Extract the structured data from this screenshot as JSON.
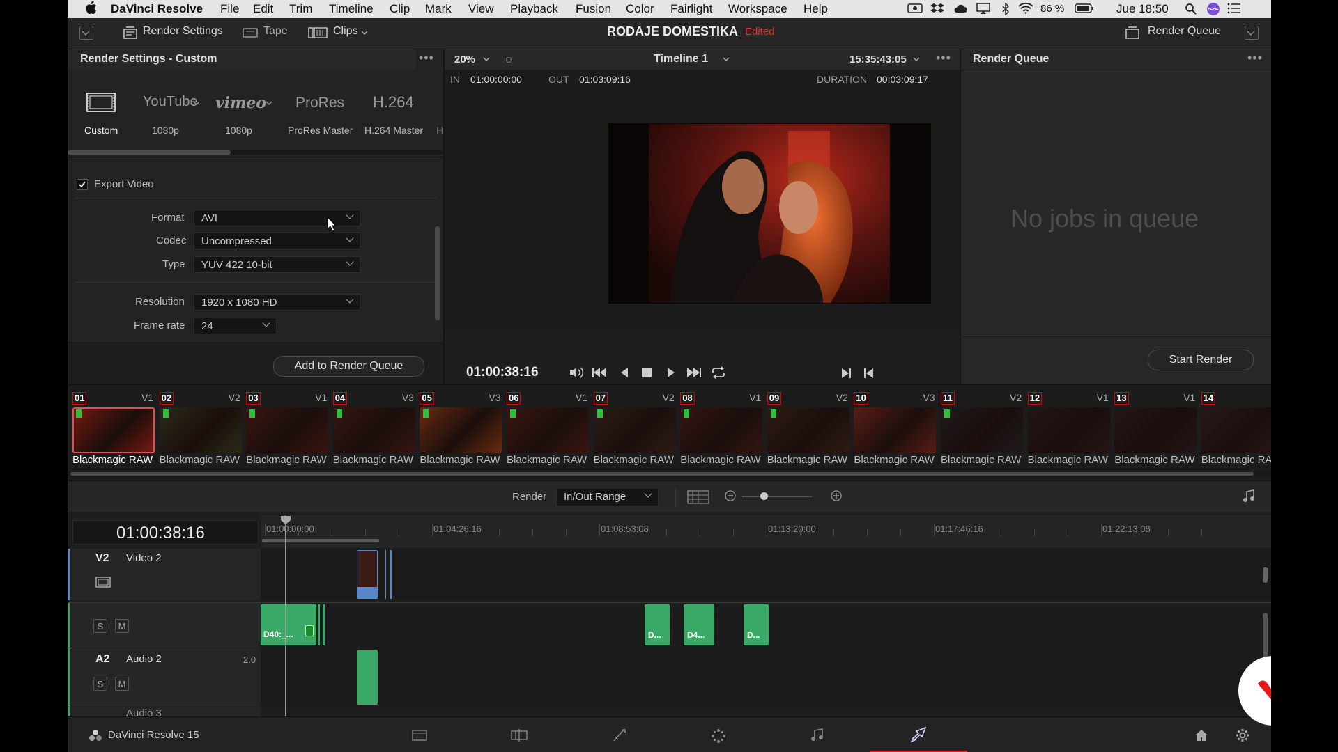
{
  "menubar": {
    "app_name": "DaVinci Resolve",
    "items": [
      "File",
      "Edit",
      "Trim",
      "Timeline",
      "Clip",
      "Mark",
      "View",
      "Playback",
      "Fusion",
      "Color",
      "Fairlight",
      "Workspace",
      "Help"
    ],
    "battery": "86 %",
    "clock": "Jue 18:50"
  },
  "toolbar": {
    "render_settings": "Render Settings",
    "tape": "Tape",
    "clips": "Clips",
    "project_name": "RODAJE DOMESTIKA",
    "edited": "Edited",
    "render_queue": "Render Queue"
  },
  "render_settings": {
    "title": "Render Settings - Custom",
    "presets": [
      {
        "name": "custom",
        "icon": "film-frame-icon",
        "label": "Custom"
      },
      {
        "name": "youtube",
        "icon": "YouTube",
        "label": "1080p"
      },
      {
        "name": "vimeo",
        "icon": "vimeo",
        "label": "1080p"
      },
      {
        "name": "prores",
        "icon": "ProRes",
        "label": "ProRes Master"
      },
      {
        "name": "h264",
        "icon": "H.264",
        "label": "H.264 Master"
      },
      {
        "name": "more",
        "icon": "",
        "label": "H"
      }
    ],
    "export_video_label": "Export Video",
    "export_video_checked": true,
    "fields": {
      "format": {
        "label": "Format",
        "value": "AVI"
      },
      "codec": {
        "label": "Codec",
        "value": "Uncompressed"
      },
      "type": {
        "label": "Type",
        "value": "YUV 422 10-bit"
      },
      "resolution": {
        "label": "Resolution",
        "value": "1920 x 1080 HD"
      },
      "frame_rate": {
        "label": "Frame rate",
        "value": "24"
      }
    },
    "add_to_queue": "Add to Render Queue"
  },
  "viewer": {
    "zoom": "20%",
    "timeline_name": "Timeline 1",
    "timecode_top": "15:35:43:05",
    "in_label": "IN",
    "in_value": "01:00:00:00",
    "out_label": "OUT",
    "out_value": "01:03:09:16",
    "duration_label": "DURATION",
    "duration_value": "00:03:09:17",
    "current_timecode": "01:00:38:16"
  },
  "render_queue": {
    "title": "Render Queue",
    "empty_message": "No jobs in queue",
    "start_render": "Start Render"
  },
  "clips": [
    {
      "num": "01",
      "track": "V1",
      "name": "Blackmagic RAW",
      "flag": true,
      "selected": true,
      "color": "#7a1a10"
    },
    {
      "num": "02",
      "track": "V2",
      "name": "Blackmagic RAW",
      "flag": true,
      "selected": false,
      "color": "#2b2b18"
    },
    {
      "num": "03",
      "track": "V1",
      "name": "Blackmagic RAW",
      "flag": true,
      "selected": false,
      "color": "#3a1410"
    },
    {
      "num": "04",
      "track": "V3",
      "name": "Blackmagic RAW",
      "flag": true,
      "selected": false,
      "color": "#351512"
    },
    {
      "num": "05",
      "track": "V3",
      "name": "Blackmagic RAW",
      "flag": true,
      "selected": false,
      "color": "#6a2a10"
    },
    {
      "num": "06",
      "track": "V1",
      "name": "Blackmagic RAW",
      "flag": true,
      "selected": false,
      "color": "#3b1612"
    },
    {
      "num": "07",
      "track": "V2",
      "name": "Blackmagic RAW",
      "flag": true,
      "selected": false,
      "color": "#2d1c16"
    },
    {
      "num": "08",
      "track": "V1",
      "name": "Blackmagic RAW",
      "flag": true,
      "selected": false,
      "color": "#341512"
    },
    {
      "num": "09",
      "track": "V2",
      "name": "Blackmagic RAW",
      "flag": true,
      "selected": false,
      "color": "#2f1a14"
    },
    {
      "num": "10",
      "track": "V3",
      "name": "Blackmagic RAW",
      "flag": false,
      "selected": false,
      "color": "#5a1d15"
    },
    {
      "num": "11",
      "track": "V2",
      "name": "Blackmagic RAW",
      "flag": true,
      "selected": false,
      "color": "#1e1a1a"
    },
    {
      "num": "12",
      "track": "V1",
      "name": "Blackmagic RAW",
      "flag": false,
      "selected": false,
      "color": "#241515"
    },
    {
      "num": "13",
      "track": "V1",
      "name": "Blackmagic RAW",
      "flag": false,
      "selected": false,
      "color": "#231616"
    },
    {
      "num": "14",
      "track": "",
      "name": "Blackmagic RA",
      "flag": false,
      "selected": false,
      "color": "#281818"
    }
  ],
  "timeline_bar": {
    "render_label": "Render",
    "range": "In/Out Range"
  },
  "timeline": {
    "timecode": "01:00:38:16",
    "ruler": [
      "01:00:00:00",
      "01:04:26:16",
      "01:08:53:08",
      "01:13:20:00",
      "01:17:46:16",
      "01:22:13:08"
    ],
    "tracks": {
      "v2": {
        "id": "V2",
        "name": "Video 2"
      },
      "a2": {
        "id": "A2",
        "name": "Audio 2",
        "channels": "2.0"
      },
      "a3_partial": "Audio 3"
    },
    "clip_labels": [
      "D40:_...",
      "D...",
      "D4...",
      "D..."
    ],
    "solo": "S",
    "mute": "M"
  },
  "footer": {
    "app_version": "DaVinci Resolve 15"
  },
  "colors": {
    "accent_red": "#e02020",
    "track_green": "#3aa866",
    "clip_blue": "#5a87c9"
  }
}
